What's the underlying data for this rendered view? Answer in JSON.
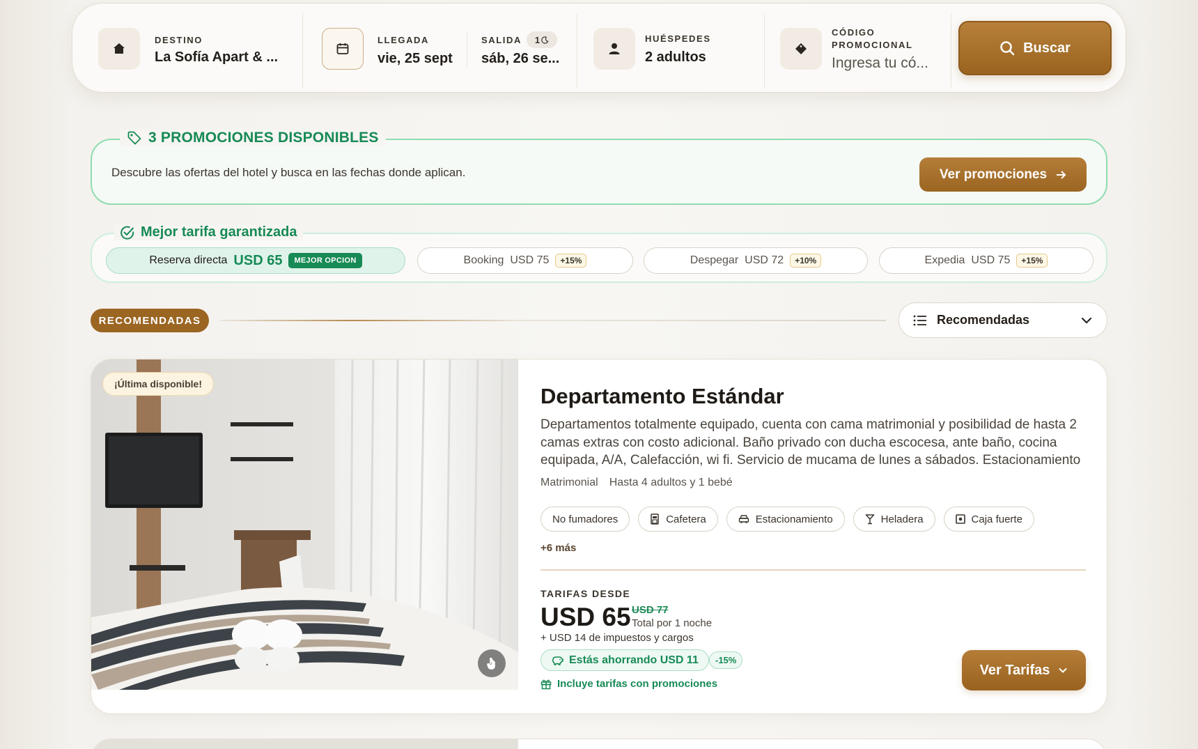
{
  "search": {
    "destination": {
      "label": "DESTINO",
      "value": "La Sofía Apart & ..."
    },
    "checkin": {
      "label": "LLEGADA",
      "value": "vie, 25 sept"
    },
    "checkout": {
      "label": "SALIDA",
      "value": "sáb, 26 se...",
      "nights": "1"
    },
    "guests": {
      "label": "HUÉSPEDES",
      "value": "2 adultos"
    },
    "promo_code": {
      "label_line1": "CÓDIGO",
      "label_line2": "PROMOCIONAL",
      "placeholder": "Ingresa tu có..."
    },
    "button_label": "Buscar"
  },
  "promotions": {
    "title": "3 PROMOCIONES DISPONIBLES",
    "description": "Descubre las ofertas del hotel y busca en las fechas donde aplican.",
    "button_label": "Ver promociones"
  },
  "best_rate": {
    "title": "Mejor tarifa garantizada",
    "direct": {
      "label": "Reserva directa",
      "price": "USD 65",
      "tag": "MEJOR OPCION"
    },
    "channels": [
      {
        "name": "Booking",
        "price": "USD 75",
        "diff": "+15%"
      },
      {
        "name": "Despegar",
        "price": "USD 72",
        "diff": "+10%"
      },
      {
        "name": "Expedia",
        "price": "USD 75",
        "diff": "+15%"
      }
    ]
  },
  "sort": {
    "section_badge": "RECOMENDADAS",
    "selected": "Recomendadas"
  },
  "room": {
    "badge": "¡Última disponible!",
    "title": "Departamento Estándar",
    "description": "Departamentos totalmente equipado, cuenta con cama matrimonial y posibilidad de hasta 2 camas extras con costo adicional. Baño privado con ducha escocesa, ante baño, cocina equipada, A/A, Calefacción, wi fi. Servicio de mucama de lunes a sábados. Estacionamiento",
    "bed": "Matrimonial",
    "capacity": "Hasta 4 adultos y 1 bebé",
    "amenities": [
      {
        "label": "No fumadores",
        "icon": ""
      },
      {
        "label": "Cafetera",
        "icon": "coffee-maker-icon"
      },
      {
        "label": "Estacionamiento",
        "icon": "car-icon"
      },
      {
        "label": "Heladera",
        "icon": "glass-icon"
      },
      {
        "label": "Caja fuerte",
        "icon": "safe-icon"
      }
    ],
    "more": "+6 más",
    "price_label": "TARIFAS DESDE",
    "price": "USD 65",
    "old_price": "USD 77",
    "price_note": "Total por 1 noche",
    "taxes": "+ USD 14 de impuestos y cargos",
    "saving": "Estás ahorrando USD 11",
    "saving_pct": "-15%",
    "promo_included": "Incluye tarifas con promociones",
    "button_label": "Ver Tarifas"
  },
  "colors": {
    "brand": "#9b6522",
    "green": "#178a55",
    "background": "#f7f6f3"
  }
}
